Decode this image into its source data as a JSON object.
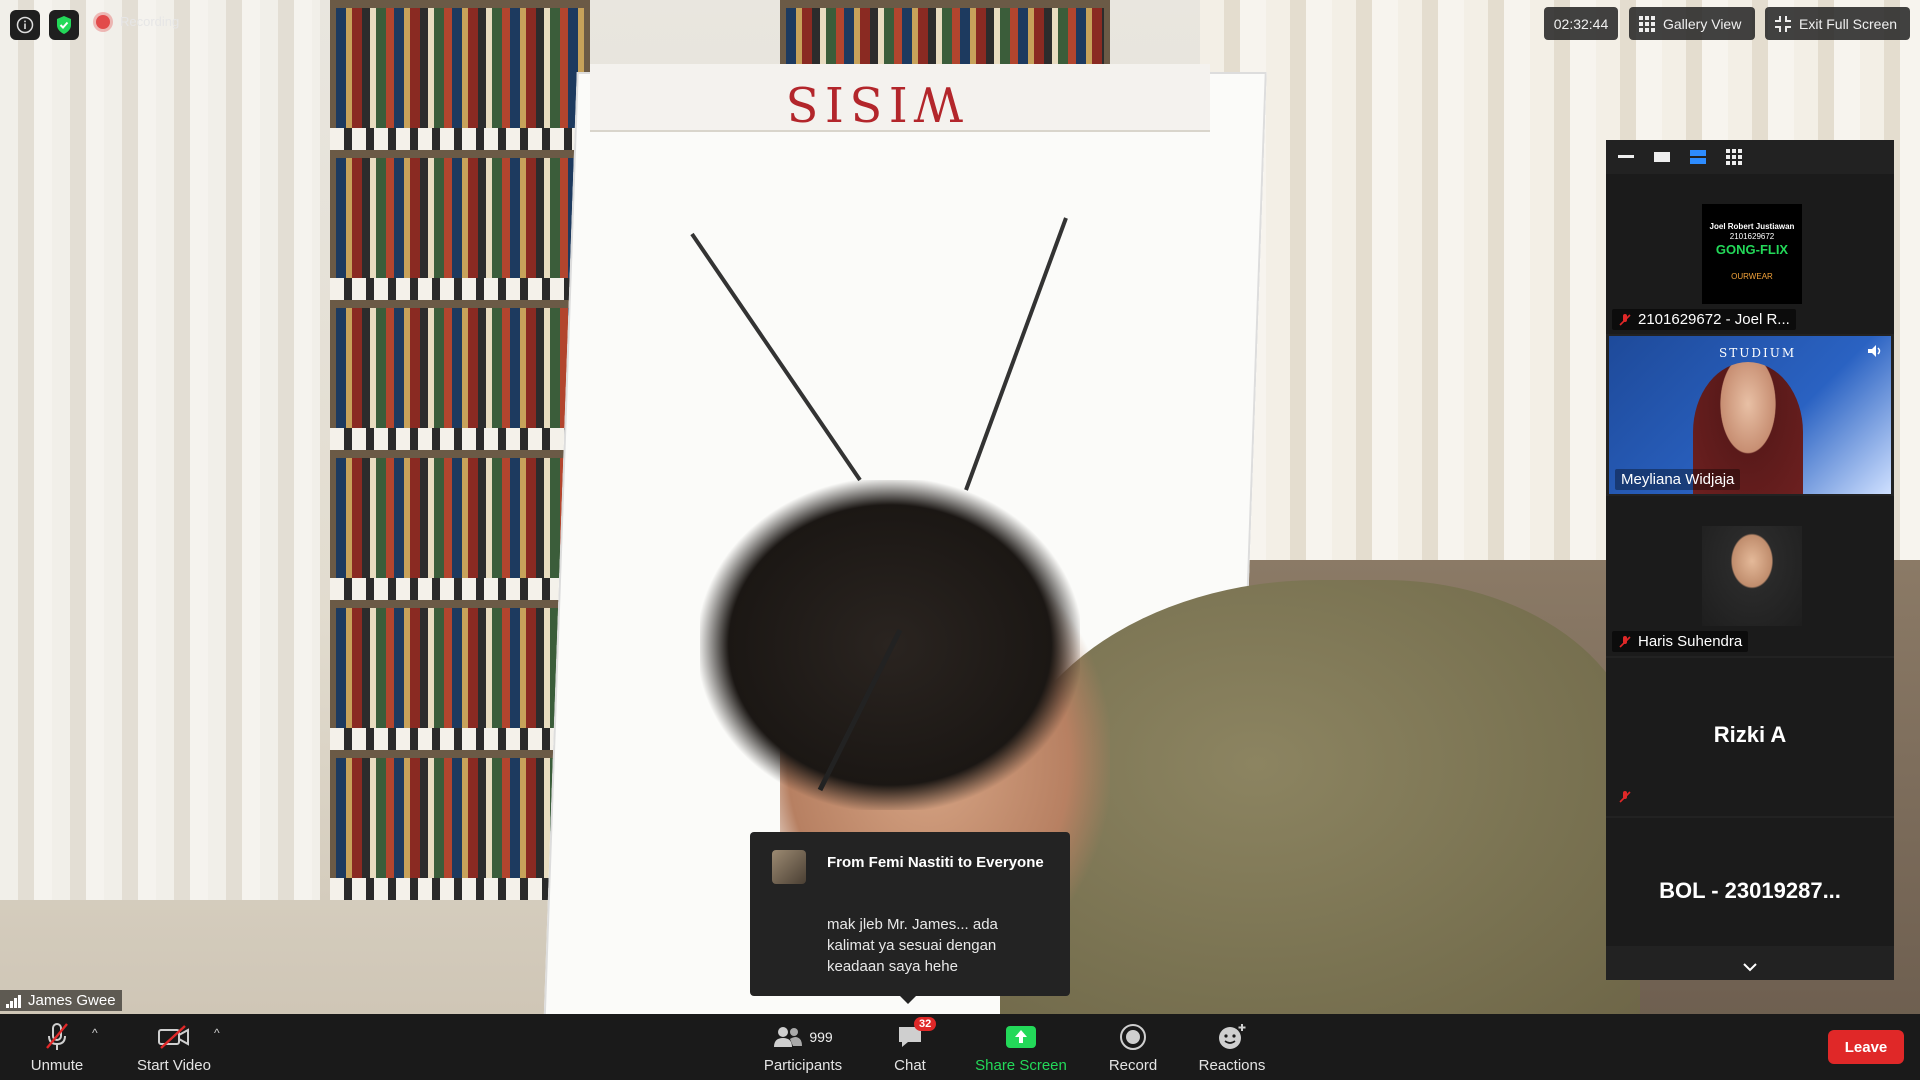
{
  "top_left": {
    "info_icon": "info-icon",
    "shield_icon": "shield-check-icon",
    "recording_label": "Recording"
  },
  "top_right": {
    "timer": "02:32:44",
    "gallery_view_label": "Gallery View",
    "exit_full_screen_label": "Exit Full Screen"
  },
  "main_video": {
    "flipchart_title": "WISIS",
    "speaker_name": "James Gwee"
  },
  "panel": {
    "tiles": [
      {
        "name": "2101629672 - Joel R...",
        "muted": true,
        "thumbnail_lines": [
          "Joel Robert Justiawan",
          "2101629672",
          "GONG-FLIX",
          "OURWEAR"
        ]
      },
      {
        "name": "Meyliana Widjaja",
        "muted": false,
        "banner_text": "STUDIUM"
      },
      {
        "name": "Haris Suhendra",
        "muted": true
      },
      {
        "name": "Rizki A",
        "muted": true
      },
      {
        "name": "BOL - 23019287...",
        "muted": false
      }
    ]
  },
  "chat_toast": {
    "title": "From Femi Nastiti to Everyone",
    "message": "mak jleb Mr. James... ada kalimat ya sesuai dengan keadaan saya hehe"
  },
  "toolbar": {
    "unmute": "Unmute",
    "start_video": "Start Video",
    "participants": "Participants",
    "participants_count": "999",
    "chat": "Chat",
    "chat_badge": "32",
    "share_screen": "Share Screen",
    "record": "Record",
    "reactions": "Reactions",
    "leave": "Leave"
  },
  "colors": {
    "accent_green": "#23d959",
    "leave_red": "#e02828",
    "recording_red": "#e24a4a",
    "panel_bg": "#222222"
  }
}
